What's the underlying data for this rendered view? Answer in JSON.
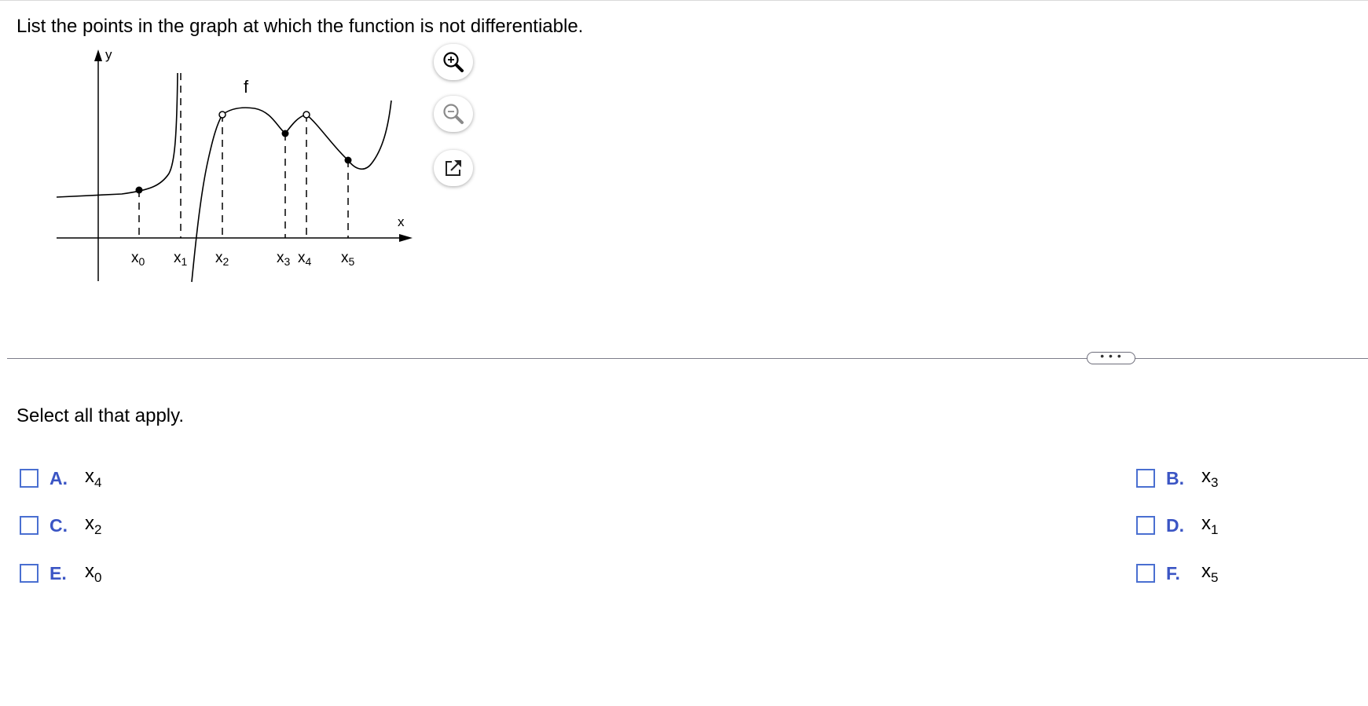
{
  "question": {
    "text": "List the points in the graph at which the function is not differentiable."
  },
  "graph": {
    "y_label": "y",
    "x_label": "x",
    "f_label": "f",
    "x_ticks": [
      {
        "base": "x",
        "sub": "0"
      },
      {
        "base": "x",
        "sub": "1"
      },
      {
        "base": "x",
        "sub": "2"
      },
      {
        "base": "x",
        "sub": "3"
      },
      {
        "base": "x",
        "sub": "4"
      },
      {
        "base": "x",
        "sub": "5"
      }
    ]
  },
  "tools": {
    "zoom_in_icon": "zoom-in-icon",
    "zoom_out_icon": "zoom-out-icon",
    "popout_icon": "popout-icon"
  },
  "more_button": {
    "label": "• • •"
  },
  "instruction": {
    "text": "Select all that apply."
  },
  "choices": [
    {
      "letter": "A.",
      "base": "x",
      "sub": "4",
      "checked": false
    },
    {
      "letter": "B.",
      "base": "x",
      "sub": "3",
      "checked": false
    },
    {
      "letter": "C.",
      "base": "x",
      "sub": "2",
      "checked": false
    },
    {
      "letter": "D.",
      "base": "x",
      "sub": "1",
      "checked": false
    },
    {
      "letter": "E.",
      "base": "x",
      "sub": "0",
      "checked": false
    },
    {
      "letter": "F.",
      "base": "x",
      "sub": "5",
      "checked": false
    }
  ],
  "colors": {
    "accent": "#3b55c4",
    "checkbox_border": "#4a6fd1",
    "divider": "#7d7d8a"
  }
}
